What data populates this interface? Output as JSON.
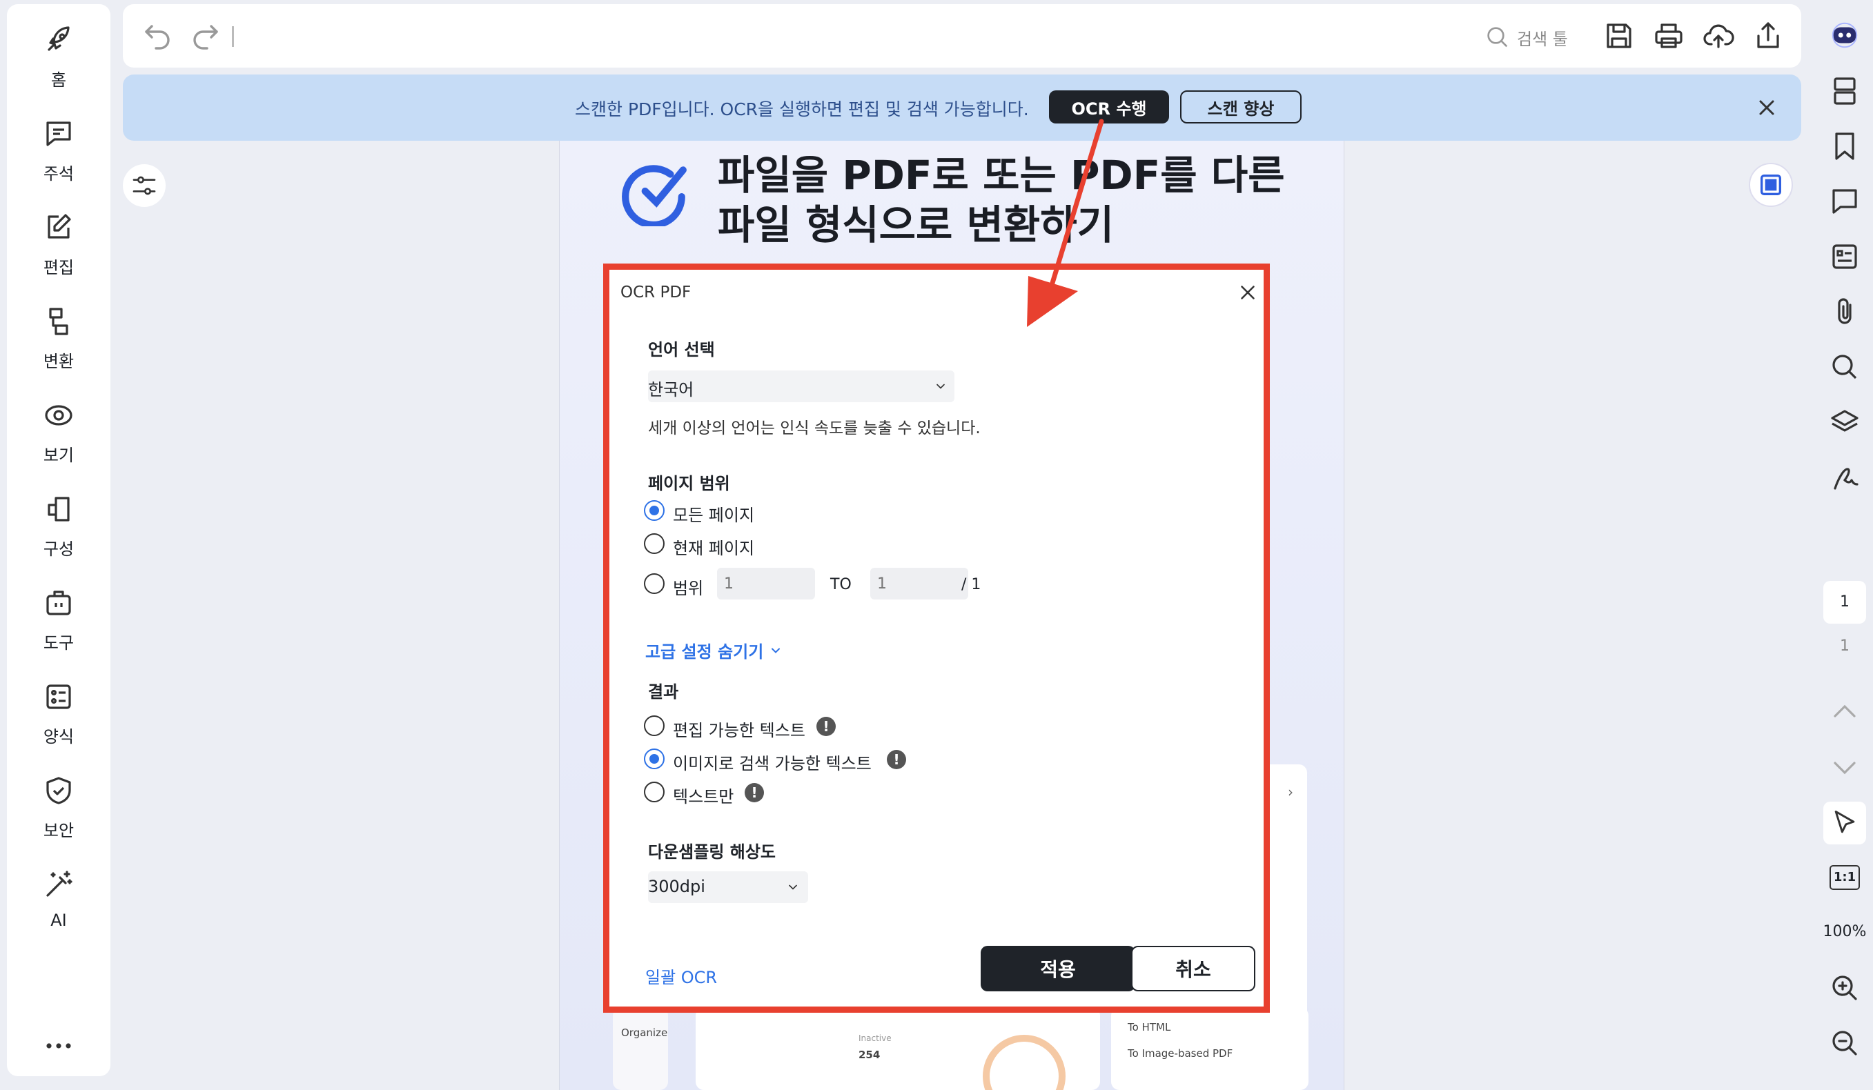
{
  "sidebar": {
    "items": [
      {
        "label": "홈",
        "icon": "rocket-icon"
      },
      {
        "label": "주석",
        "icon": "comment-icon"
      },
      {
        "label": "편집",
        "icon": "edit-icon"
      },
      {
        "label": "변환",
        "icon": "convert-icon"
      },
      {
        "label": "보기",
        "icon": "eye-icon"
      },
      {
        "label": "구성",
        "icon": "organize-icon"
      },
      {
        "label": "도구",
        "icon": "toolbox-icon"
      },
      {
        "label": "양식",
        "icon": "form-icon"
      },
      {
        "label": "보안",
        "icon": "shield-icon"
      },
      {
        "label": "AI",
        "icon": "magic-wand-icon"
      }
    ],
    "more_icon": "more-icon"
  },
  "toolbar": {
    "search_placeholder": "검색 툴"
  },
  "banner": {
    "message": "스캔한 PDF입니다. OCR을 실행하면 편집 및 검색 가능합니다.",
    "ocr_button": "OCR 수행",
    "enhance_button": "스캔 향상",
    "bg_color": "#c6dcf6"
  },
  "document": {
    "title_line1": "파일을 PDF로 또는 PDF를 다른",
    "title_line2": "파일 형식으로 변환하기",
    "snippets": {
      "organize": "Organize",
      "inactive": "Inactive",
      "value": "254",
      "to_html": "To HTML",
      "to_image_pdf": "To Image-based PDF"
    }
  },
  "dialog": {
    "title": "OCR PDF",
    "language_section": "언어 선택",
    "language_value": "한국어",
    "language_hint": "세개 이상의 언어는 인식 속도를 늦출 수 있습니다.",
    "page_range_section": "페이지 범위",
    "range_options": [
      "모든 페이지",
      "현재 페이지",
      "범위"
    ],
    "range_selected": 0,
    "range_from_placeholder": "1",
    "range_to_label": "TO",
    "range_to_placeholder": "1",
    "range_total": "/ 1",
    "advanced_toggle": "고급 설정 숨기기",
    "result_section": "결과",
    "result_options": [
      "편집 가능한 텍스트",
      "이미지로 검색 가능한 텍스트",
      "텍스트만"
    ],
    "result_selected": 1,
    "downsample_section": "다운샘플링 해상도",
    "downsample_value": "300dpi",
    "batch_link": "일괄 OCR",
    "apply_button": "적용",
    "cancel_button": "취소",
    "accent_color": "#2e72e6",
    "highlight_color": "#e8402f"
  },
  "rightbar": {
    "page_current": "1",
    "page_total": "1",
    "zoom": "100%",
    "actual_size": "1:1"
  }
}
